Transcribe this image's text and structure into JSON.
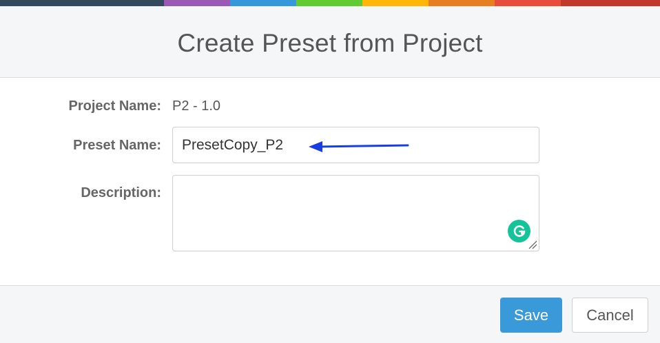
{
  "theme": {
    "color_bar": [
      "#34495e",
      "#9b59b6",
      "#3498db",
      "#62cb31",
      "#ffb606",
      "#e67e22",
      "#e74c3c",
      "#c0392b"
    ],
    "accent": "#3a9ad9",
    "grammarly_green": "#15c39a",
    "arrow_color": "#1a3de0"
  },
  "dialog": {
    "title": "Create Preset from Project"
  },
  "form": {
    "project_name_label": "Project Name:",
    "project_name_value": "P2 - 1.0",
    "preset_name_label": "Preset Name:",
    "preset_name_value": "PresetCopy_P2",
    "description_label": "Description:",
    "description_value": ""
  },
  "footer": {
    "save_label": "Save",
    "cancel_label": "Cancel"
  },
  "icons": {
    "grammarly": "grammarly-icon",
    "resize": "resize-handle-icon",
    "annotation": "blue-arrow-icon"
  }
}
